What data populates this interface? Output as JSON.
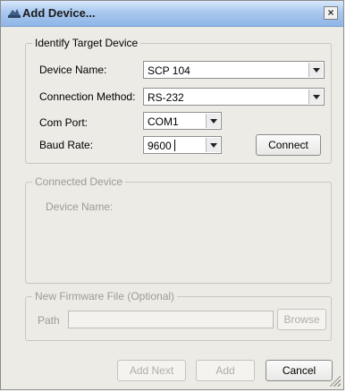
{
  "window": {
    "title": "Add Device..."
  },
  "identify_group": {
    "legend": "Identify Target Device",
    "device_name": {
      "label": "Device Name:",
      "value": "SCP 104"
    },
    "connection_method": {
      "label": "Connection Method:",
      "value": "RS-232"
    },
    "com_port": {
      "label": "Com Port:",
      "value": "COM1"
    },
    "baud_rate": {
      "label": "Baud Rate:",
      "value": "9600"
    },
    "connect_label": "Connect"
  },
  "connected_group": {
    "legend": "Connected Device",
    "device_name_label": "Device Name:"
  },
  "firmware_group": {
    "legend": "New Firmware File (Optional)",
    "path_label": "Path",
    "path_value": "",
    "browse_label": "Browse"
  },
  "buttons": {
    "add_next": "Add Next",
    "add": "Add",
    "cancel": "Cancel"
  },
  "icons": {
    "app": "device-app-icon",
    "close": "close-icon",
    "dropdown": "chevron-down-icon",
    "grip": "resize-grip-icon"
  }
}
